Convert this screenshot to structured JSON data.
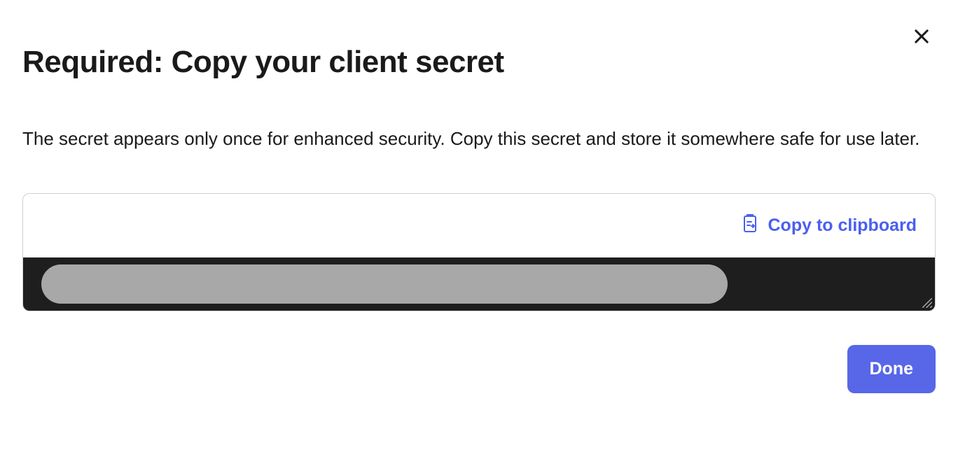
{
  "dialog": {
    "title": "Required: Copy your client secret",
    "description": "The secret appears only once for enhanced security. Copy this secret and store it somewhere safe for use later.",
    "copy_label": "Copy to clipboard",
    "done_label": "Done"
  }
}
